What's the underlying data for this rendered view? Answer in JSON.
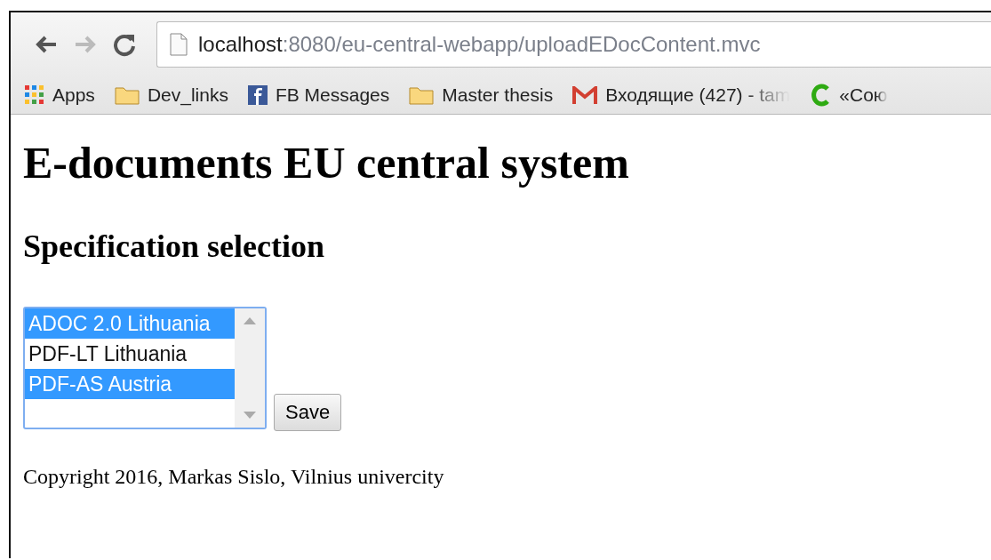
{
  "browser": {
    "address": {
      "host": "localhost",
      "path": ":8080/eu-central-webapp/uploadEDocContent.mvc"
    },
    "bookmarks": [
      {
        "kind": "apps",
        "label": "Apps"
      },
      {
        "kind": "folder",
        "label": "Dev_links"
      },
      {
        "kind": "facebook",
        "label": "FB Messages"
      },
      {
        "kind": "folder",
        "label": "Master thesis"
      },
      {
        "kind": "mail",
        "label": "Входящие (427) - tam"
      },
      {
        "kind": "c",
        "label": "«Сою"
      }
    ]
  },
  "page": {
    "title": "E-documents EU central system",
    "subtitle": "Specification selection",
    "options": [
      {
        "label": "ADOC 2.0 Lithuania",
        "selected": true
      },
      {
        "label": "PDF-LT Lithuania",
        "selected": false
      },
      {
        "label": "PDF-AS Austria",
        "selected": true
      }
    ],
    "button": "Save",
    "footer": "Copyright 2016, Markas Sislo, Vilnius univercity"
  }
}
